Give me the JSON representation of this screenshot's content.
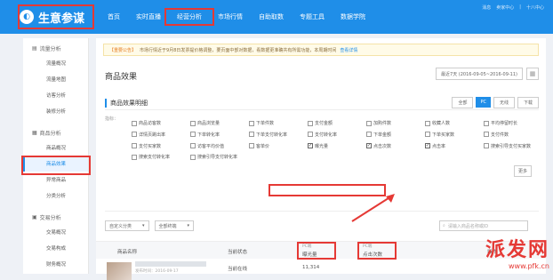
{
  "header": {
    "logo_text": "生意参谋",
    "nav": [
      "首页",
      "实时直播",
      "经营分析",
      "市场行情",
      "自助取数",
      "专题工具",
      "数据学院"
    ],
    "active_nav": "经营分析",
    "utils": [
      "消息",
      "卖家中心",
      "|",
      "十八中心"
    ]
  },
  "sidebar": {
    "groups": [
      {
        "title": "流量分析",
        "items": [
          "流量概况",
          "流量地图",
          "访客分析",
          "装修分析"
        ]
      },
      {
        "title": "商品分析",
        "items": [
          "商品概况",
          "商品效果",
          "异常商品",
          "分类分析"
        ]
      },
      {
        "title": "交易分析",
        "items": [
          "交易概况",
          "交易构成",
          "财务概况"
        ]
      }
    ],
    "active_item": "商品效果"
  },
  "notice": {
    "tag": "【重要公告】",
    "text": "市场行情近于9月8日发票提价格调整，要页面中部对数据，看数据更准确共有所需功能，本周期时间",
    "link": "查看详情"
  },
  "page": {
    "title": "商品效果",
    "date_label": "最近7天 (2016-09-05~2016-09-11)",
    "sub_title": "商品效果明细",
    "tabs": [
      "全部",
      "PC",
      "无线",
      "下载"
    ]
  },
  "metrics": {
    "label": "指标：",
    "more": "更多",
    "items": [
      {
        "label": "商品访客数",
        "checked": false
      },
      {
        "label": "商品浏览量",
        "checked": false
      },
      {
        "label": "下单件数",
        "checked": false
      },
      {
        "label": "支付金额",
        "checked": false
      },
      {
        "label": "加购件数",
        "checked": false
      },
      {
        "label": "收藏人数",
        "checked": false
      },
      {
        "label": "平均停留时长",
        "checked": false
      },
      {
        "label": "详情页跳出率",
        "checked": false
      },
      {
        "label": "下单转化率",
        "checked": false
      },
      {
        "label": "下单支付转化率",
        "checked": false
      },
      {
        "label": "支付转化率",
        "checked": false
      },
      {
        "label": "下单金额",
        "checked": false
      },
      {
        "label": "下单买家数",
        "checked": false
      },
      {
        "label": "支付件数",
        "checked": false
      },
      {
        "label": "支付买家数",
        "checked": false
      },
      {
        "label": "访客平均价值",
        "checked": false
      },
      {
        "label": "客单价",
        "checked": false
      },
      {
        "label": "曝光量",
        "checked": true
      },
      {
        "label": "点击次数",
        "checked": true
      },
      {
        "label": "点击率",
        "checked": true
      },
      {
        "label": "搜索引导支付买家数",
        "checked": false
      },
      {
        "label": "搜索支付转化率",
        "checked": false
      },
      {
        "label": "搜索引导支付转化率",
        "checked": false
      }
    ]
  },
  "filters": {
    "category": "自定义分类",
    "terminal": "全部终端",
    "search_placeholder": "请输入商品名称或ID"
  },
  "table": {
    "headers": [
      "商品名称",
      "当前状态",
      "曝光量",
      "点击次数",
      "操作"
    ],
    "head_sub": [
      "PC端",
      "PC端"
    ],
    "rows": [
      {
        "name": "",
        "time": "发布时间：2016-09-17",
        "status": "当前在线",
        "impressions": "11,314",
        "clicks": ""
      }
    ]
  },
  "watermark": {
    "brand": "派发网",
    "url": "www.pfk.cn"
  }
}
